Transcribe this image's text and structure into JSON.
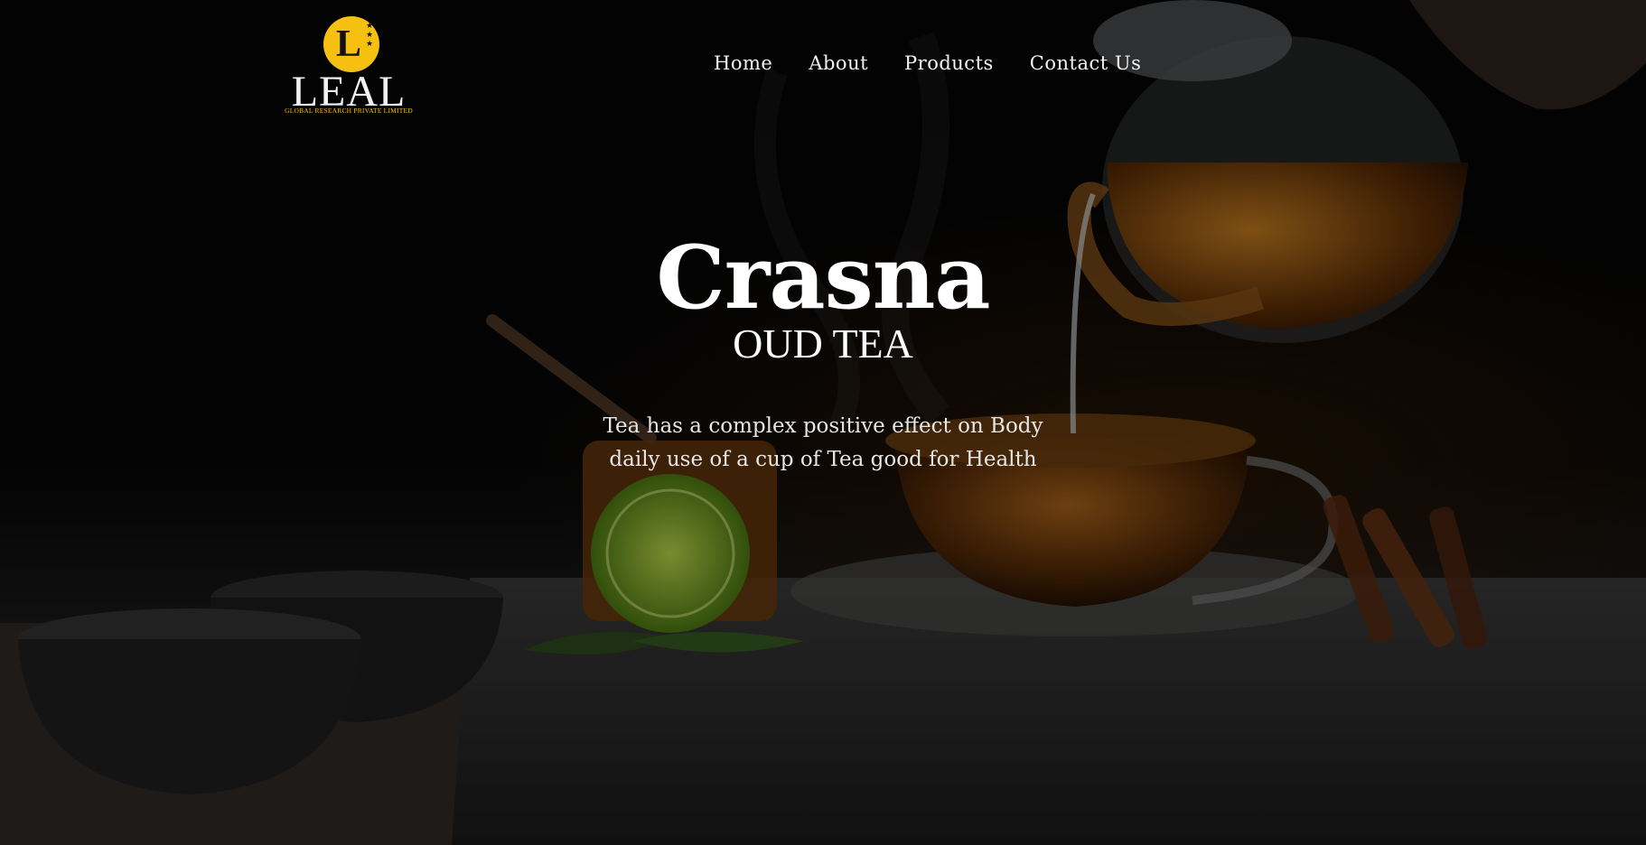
{
  "brand": {
    "logo_letter": "L",
    "name": "LEAL",
    "tagline": "GLOBAL RESEARCH PRIVATE LIMITED",
    "accent_color": "#f5c010"
  },
  "nav": {
    "items": [
      {
        "label": "Home"
      },
      {
        "label": "About"
      },
      {
        "label": "Products"
      },
      {
        "label": "Contact Us"
      }
    ]
  },
  "hero": {
    "title": "Crasna",
    "subtitle": "OUD TEA",
    "description_line1": "Tea has a complex positive effect on Body",
    "description_line2": "daily use of a cup of Tea good for Health",
    "background_image": "tea-pouring-into-glass-cup-photo"
  }
}
